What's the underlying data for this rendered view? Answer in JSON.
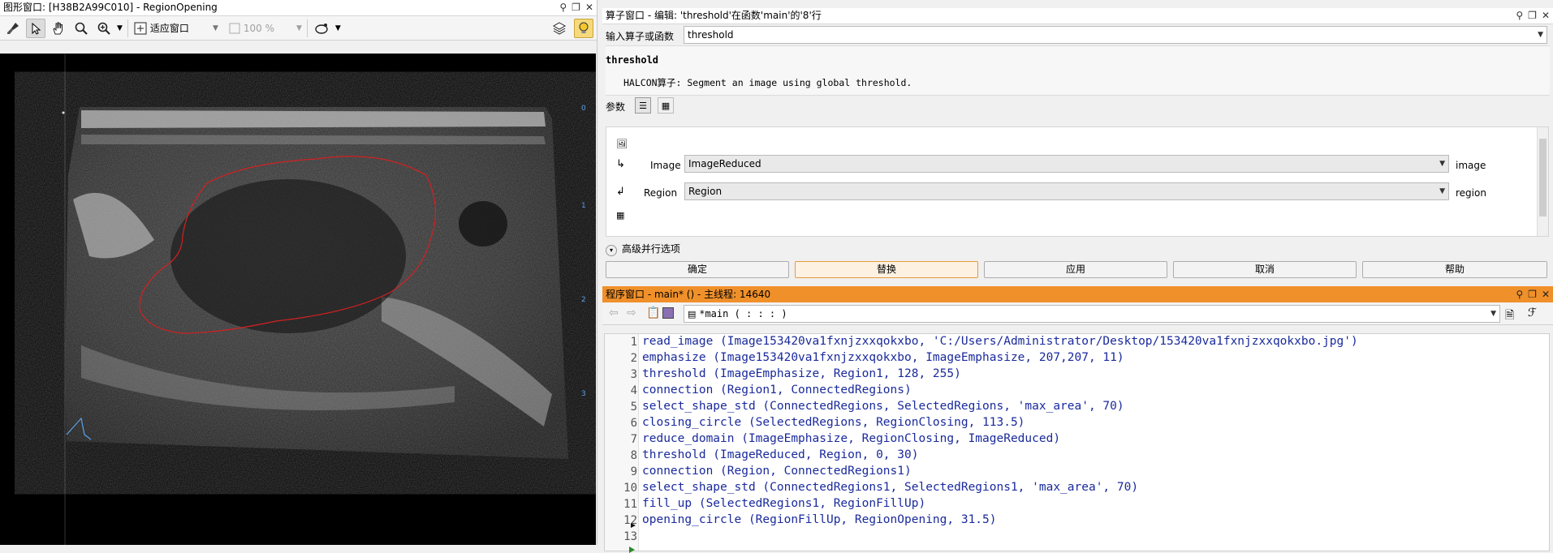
{
  "graphics_window": {
    "title": "图形窗口: [H38B2A99C010] - RegionOpening",
    "fit_label": "适应窗口",
    "zoom": "100 %",
    "ruler_labels": [
      "0",
      "1",
      "2",
      "3"
    ]
  },
  "operator_window": {
    "title": "算子窗口 - 编辑: 'threshold'在函数'main'的'8'行",
    "input_label": "输入算子或函数",
    "input_value": "threshold",
    "operator_name": "threshold",
    "description": "HALCON算子: Segment an image using global threshold.",
    "params_label": "参数",
    "params": [
      {
        "name": "Image",
        "value": "ImageReduced",
        "type": "image"
      },
      {
        "name": "Region",
        "value": "Region",
        "type": "region"
      }
    ],
    "advanced_label": "高级并行选项",
    "buttons": {
      "ok": "确定",
      "replace": "替换",
      "apply": "应用",
      "cancel": "取消",
      "help": "帮助"
    }
  },
  "program_window": {
    "title": "程序窗口 - main* () - 主线程: 14640",
    "procedure": "*main ( : : : )",
    "lines": [
      "read_image (Image153420va1fxnjzxxqokxbo, 'C:/Users/Administrator/Desktop/153420va1fxnjzxxqokxbo.jpg')",
      "emphasize (Image153420va1fxnjzxxqokxbo, ImageEmphasize, 207,207, 11)",
      "threshold (ImageEmphasize, Region1, 128, 255)",
      "connection (Region1, ConnectedRegions)",
      "select_shape_std (ConnectedRegions, SelectedRegions, 'max_area', 70)",
      "closing_circle (SelectedRegions, RegionClosing, 113.5)",
      "reduce_domain (ImageEmphasize, RegionClosing, ImageReduced)",
      "threshold (ImageReduced, Region, 0, 30)",
      "connection (Region, ConnectedRegions1)",
      "select_shape_std (ConnectedRegions1, SelectedRegions1, 'max_area', 70)",
      "fill_up (SelectedRegions1, RegionFillUp)",
      "opening_circle (RegionFillUp, RegionOpening, 31.5)",
      ""
    ],
    "line_numbers": [
      "1",
      "2",
      "3",
      "4",
      "5",
      "6",
      "7",
      "8",
      "9",
      "10",
      "11",
      "12",
      "13"
    ]
  },
  "colors": {
    "program_title_bg": "#f0902a",
    "code_text": "#1a2a9c",
    "region_outline": "#d42020",
    "highlight_button_border": "#e59a3e"
  }
}
